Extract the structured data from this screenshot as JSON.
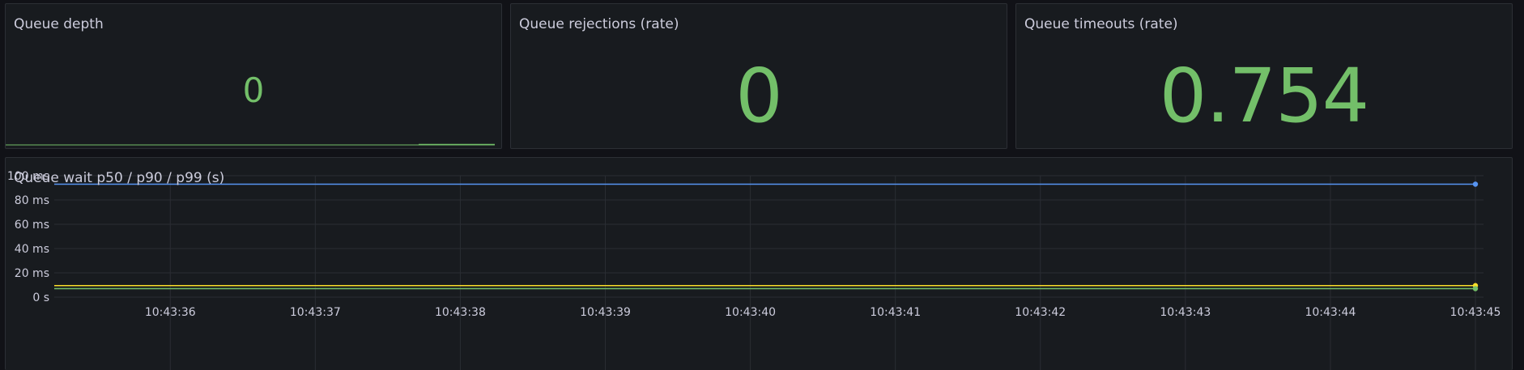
{
  "panels": {
    "queue_depth": {
      "title": "Queue depth",
      "value": "0"
    },
    "queue_rejections": {
      "title": "Queue rejections (rate)",
      "value": "0"
    },
    "queue_timeouts": {
      "title": "Queue timeouts (rate)",
      "value": "0.754"
    },
    "queue_wait": {
      "title": "Queue wait p50 / p90 / p99 (s)"
    }
  },
  "colors": {
    "value_green": "#73bf69",
    "series_blue": "#5794f2",
    "series_yellow": "#fade2a",
    "series_green": "#73bf69"
  },
  "chart_data": {
    "type": "line",
    "title": "Queue wait p50 / p90 / p99 (s)",
    "y_tick_labels": [
      "100 ms",
      "80 ms",
      "60 ms",
      "40 ms",
      "20 ms",
      "0 s"
    ],
    "y_ticks": [
      100,
      80,
      60,
      40,
      20,
      0
    ],
    "ylim": [
      0,
      100
    ],
    "x_tick_labels": [
      "10:43:36",
      "10:43:37",
      "10:43:38",
      "10:43:39",
      "10:43:40",
      "10:43:41",
      "10:43:42",
      "10:43:43",
      "10:43:44",
      "10:43:45"
    ],
    "xlim": [
      "10:43:35.2",
      "10:43:45"
    ],
    "grid": true,
    "series": [
      {
        "color": "#5794f2",
        "x": [
          "10:43:35.2",
          "10:43:45"
        ],
        "values": [
          93,
          93
        ]
      },
      {
        "color": "#fade2a",
        "x": [
          "10:43:35.2",
          "10:43:45"
        ],
        "values": [
          9.5,
          9.5
        ]
      },
      {
        "color": "#73bf69",
        "x": [
          "10:43:35.2",
          "10:43:45"
        ],
        "values": [
          7,
          7
        ]
      }
    ]
  }
}
